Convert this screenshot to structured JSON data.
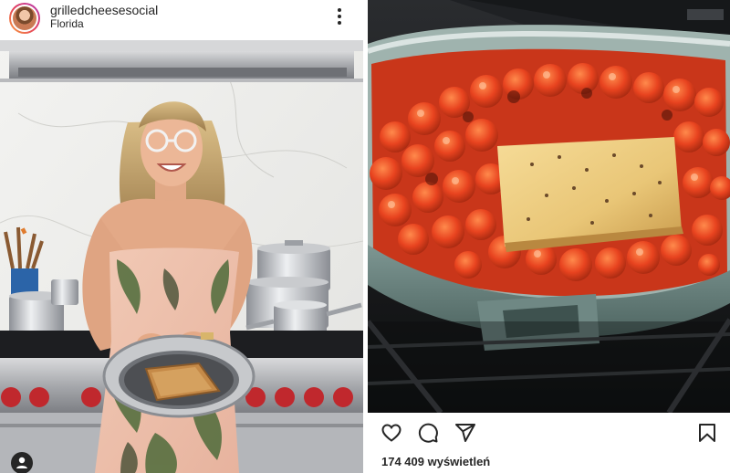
{
  "left_post": {
    "username": "grilledcheesesocial",
    "location": "Florida",
    "header_icons": {
      "avatar": "profile-avatar",
      "more": "more-options-icon"
    },
    "image_icons": {
      "tag": "user-tag-icon"
    }
  },
  "right_post": {
    "views": "174 409 wyświetleń",
    "actions": [
      "heart-icon",
      "comment-icon",
      "share-icon",
      "bookmark-icon"
    ]
  }
}
